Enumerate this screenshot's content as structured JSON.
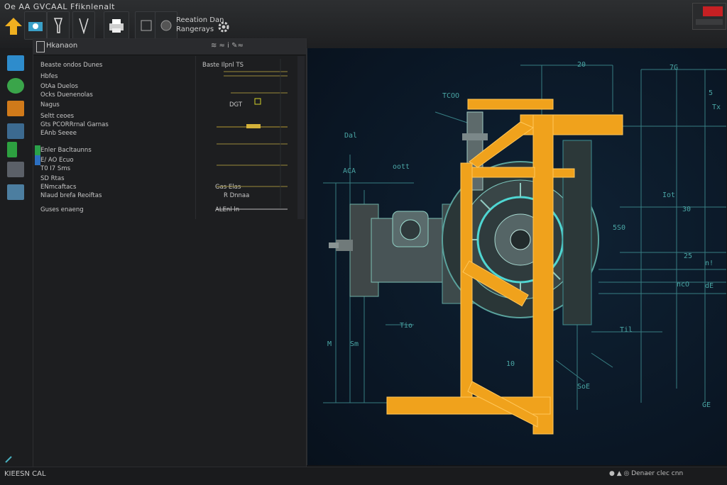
{
  "app": {
    "title": "Oe AA GVCAAL Ffiknlenalt"
  },
  "ribbon": {
    "group_label_line1": "Reeation Dan",
    "group_label_line2": "Rangerays"
  },
  "panel": {
    "title": "Hkanaon",
    "header_icons": "≋ ≈    i  ✎≈",
    "rows": [
      {
        "label": "Beaste ondos Dunes",
        "value": "Baste Ilpnl TS"
      },
      {
        "label": "Hbfes",
        "value": ""
      },
      {
        "label": "OtAa Duelos",
        "value": ""
      },
      {
        "label": "Ocks Duenenolas",
        "value": ""
      },
      {
        "label": "Nagus",
        "value": "DGT"
      },
      {
        "label": "Seltt ceoes",
        "value": ""
      },
      {
        "label": "Gts PCORRrnal Garnas",
        "value": ""
      },
      {
        "label": "EAnb Seeee",
        "value": ""
      },
      {
        "label": "Enler Bacltaunns",
        "value": ""
      },
      {
        "label": "E/ AO Ecuo",
        "value": ""
      },
      {
        "label": "T0 I7 Sms",
        "value": ""
      },
      {
        "label": "SD Rtas",
        "value": ""
      },
      {
        "label": "ENmcaftacs",
        "value": "Gas   Elas"
      },
      {
        "label": "Nlaud brefa Reoiftas",
        "value": "R Dnnaa"
      },
      {
        "label": "Guses enaeng",
        "value": "ALEnl  ln"
      }
    ]
  },
  "viewport": {
    "dims": [
      "20",
      "7G",
      "5",
      "Tx",
      "TCOO",
      "Dal",
      "oott",
      "ACA",
      "Iot",
      "30",
      "5S0",
      "25",
      "n!",
      "dE",
      "ncO",
      "Til",
      "M",
      "Tio",
      "10",
      "Sm",
      "SoE",
      "GE"
    ]
  },
  "status": {
    "left": "KIEESN CAL",
    "right": "●  ▲  ◎  Denaer clec cnn"
  },
  "colors": {
    "frame_orange": "#f0a21c",
    "blueprint_line": "#4aa6a5",
    "background_blue": "#0b1826"
  }
}
